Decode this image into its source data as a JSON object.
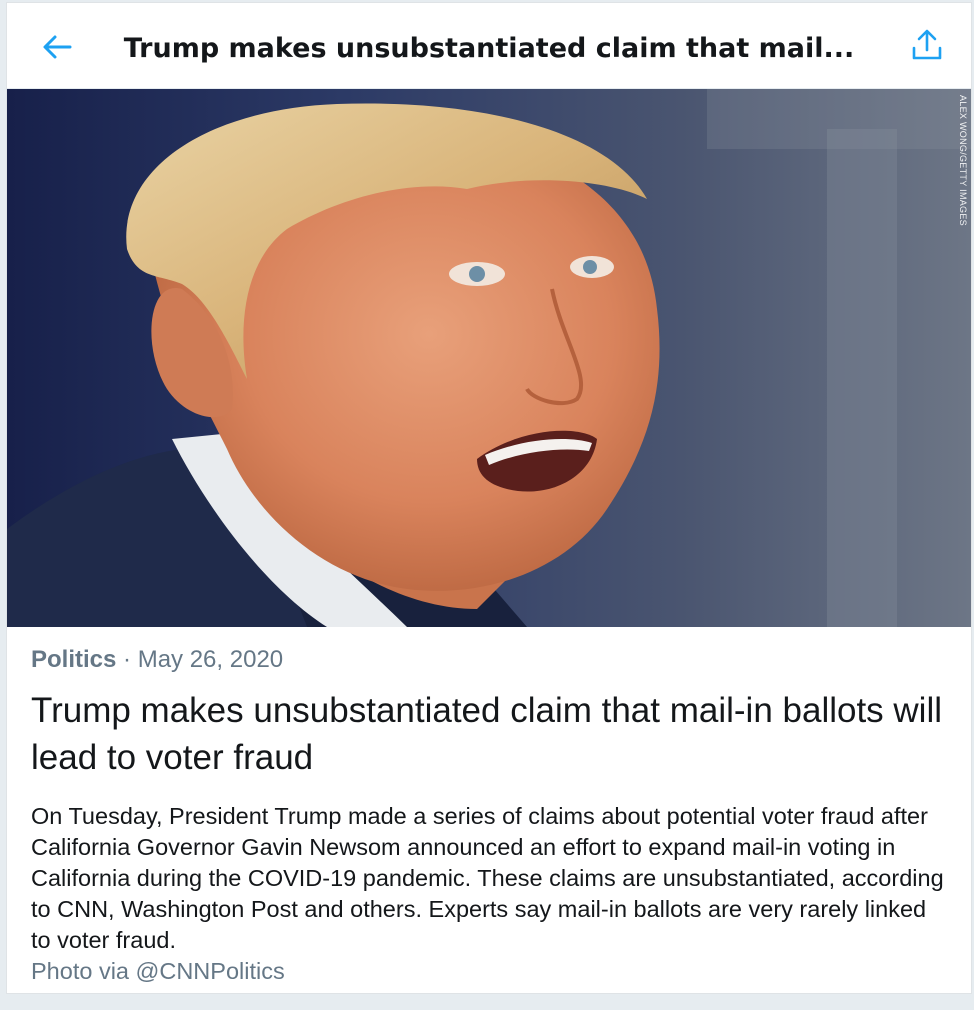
{
  "header": {
    "title": "Trump makes unsubstantiated claim that mail...",
    "back_icon": "arrow-left-icon",
    "share_icon": "share-icon",
    "accent_color": "#1da1f2"
  },
  "hero": {
    "credit": "ALEX WONG/GETTY IMAGES"
  },
  "article": {
    "category": "Politics",
    "separator": "·",
    "date": "May 26, 2020",
    "headline": "Trump makes unsubstantiated claim that mail-in ballots will lead to voter fraud",
    "summary": "On Tuesday, President Trump made a series of claims about potential voter fraud after California Governor Gavin Newsom announced an effort to expand mail-in voting in California during the COVID-19 pandemic. These claims are unsubstantiated, according to CNN, Washington Post and others. Experts say mail-in ballots are very rarely linked to voter fraud.",
    "attribution": "Photo via @CNNPolitics"
  }
}
